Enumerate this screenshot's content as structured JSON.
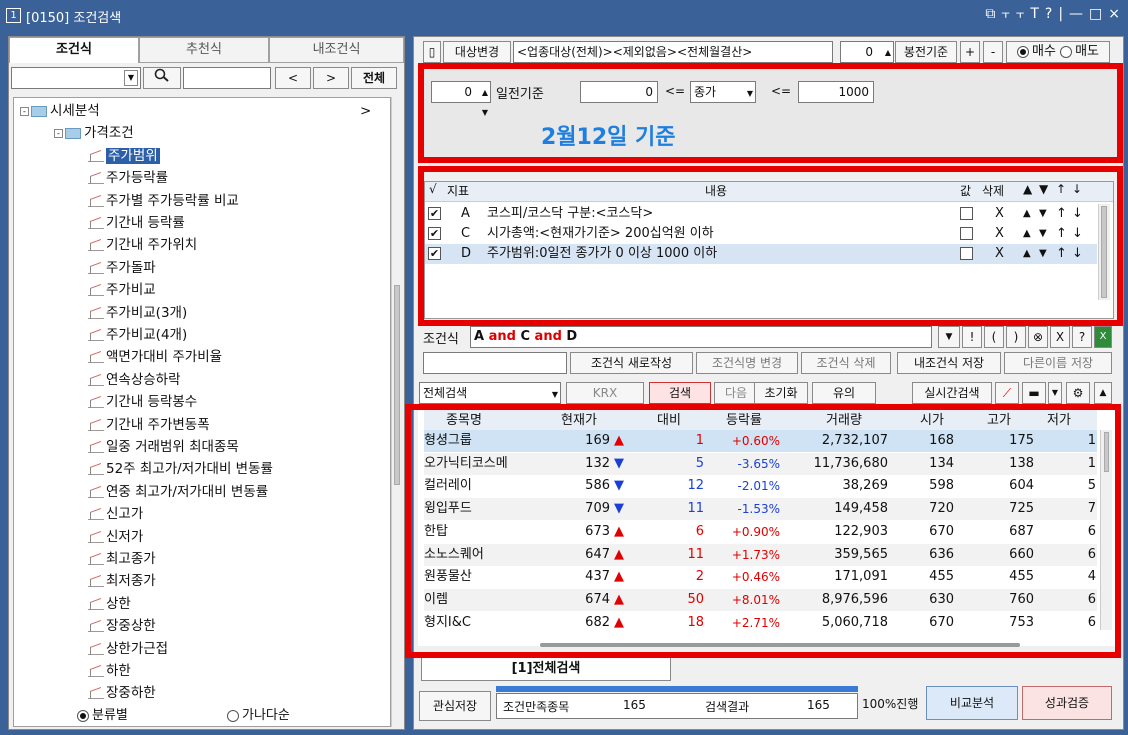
{
  "window": {
    "number": "1",
    "title": "[0150] 조건검색",
    "controls": [
      "⧉",
      "⫟",
      "⫟",
      "T",
      "?",
      "|",
      "—",
      "□",
      "×"
    ]
  },
  "left": {
    "tabs": [
      "조건식",
      "추천식",
      "내조건식"
    ],
    "all_button": "전체",
    "nav_prev": "<",
    "nav_next": ">",
    "tree": [
      {
        "label": "시세분석",
        "level": 0,
        "type": "folder",
        "expand": "-",
        "arrow": ">"
      },
      {
        "label": "가격조건",
        "level": 1,
        "type": "folder",
        "expand": "-"
      },
      {
        "label": "주가범위",
        "level": 2,
        "type": "item",
        "selected": true
      },
      {
        "label": "주가등락률",
        "level": 2,
        "type": "item"
      },
      {
        "label": "주가별 주가등락률 비교",
        "level": 2,
        "type": "item"
      },
      {
        "label": "기간내 등락률",
        "level": 2,
        "type": "item"
      },
      {
        "label": "기간내 주가위치",
        "level": 2,
        "type": "item"
      },
      {
        "label": "주가돌파",
        "level": 2,
        "type": "item"
      },
      {
        "label": "주가비교",
        "level": 2,
        "type": "item"
      },
      {
        "label": "주가비교(3개)",
        "level": 2,
        "type": "item"
      },
      {
        "label": "주가비교(4개)",
        "level": 2,
        "type": "item"
      },
      {
        "label": "액면가대비 주가비율",
        "level": 2,
        "type": "item"
      },
      {
        "label": "연속상승하락",
        "level": 2,
        "type": "item"
      },
      {
        "label": "기간내 등락봉수",
        "level": 2,
        "type": "item"
      },
      {
        "label": "기간내 주가변동폭",
        "level": 2,
        "type": "item"
      },
      {
        "label": "일중 거래범위 최대종목",
        "level": 2,
        "type": "item"
      },
      {
        "label": "52주 최고가/저가대비 변동률",
        "level": 2,
        "type": "item"
      },
      {
        "label": "연중 최고가/저가대비 변동률",
        "level": 2,
        "type": "item"
      },
      {
        "label": "신고가",
        "level": 2,
        "type": "item"
      },
      {
        "label": "신저가",
        "level": 2,
        "type": "item"
      },
      {
        "label": "최고종가",
        "level": 2,
        "type": "item"
      },
      {
        "label": "최저종가",
        "level": 2,
        "type": "item"
      },
      {
        "label": "상한",
        "level": 2,
        "type": "item"
      },
      {
        "label": "장중상한",
        "level": 2,
        "type": "item"
      },
      {
        "label": "상한가근접",
        "level": 2,
        "type": "item"
      },
      {
        "label": "하한",
        "level": 2,
        "type": "item"
      },
      {
        "label": "장중하한",
        "level": 2,
        "type": "item"
      }
    ],
    "sort_options": [
      "분류별",
      "가나다순"
    ],
    "sort_selected": "분류별"
  },
  "right": {
    "target_button": "대상변경",
    "target_text": "<업종대상(전체)><제외없음><전체월결산>",
    "bong_value": "0",
    "bong_label": "봉전기준",
    "plus": "+",
    "minus": "-",
    "trade_options": [
      "매수",
      "매도"
    ],
    "trade_selected": "매수",
    "param": {
      "days": "0",
      "days_label": "일전기준",
      "from": "0",
      "op1": "<=",
      "field": "종가",
      "op2": "<=",
      "to": "1000"
    },
    "annotation": "2월12일 기준",
    "cond_header": {
      "check": "√",
      "idx": "지표",
      "content": "내용",
      "value": "값",
      "delete": "삭제",
      "ord": [
        "▲",
        "▼",
        "↑",
        "↓"
      ]
    },
    "conditions": [
      {
        "checked": "✔",
        "idx": "A",
        "text": "코스피/코스닥 구분:<코스닥>",
        "del": "X"
      },
      {
        "checked": "✔",
        "idx": "C",
        "text": "시가총액:<현재가기준> 200십억원 이하",
        "del": "X"
      },
      {
        "checked": "✔",
        "idx": "D",
        "text": "주가범위:0일전 종가가 0 이상 1000 이하",
        "del": "X"
      }
    ],
    "formula_label": "조건식",
    "formula": [
      "A",
      "and",
      "C",
      "and",
      "D"
    ],
    "formula_tools": [
      "▼",
      "!",
      "(",
      ")",
      "⊗",
      "X",
      "?"
    ],
    "buttons_row1": [
      "조건식 새로작성",
      "조건식명 변경",
      "조건식 삭제",
      "내조건식 저장",
      "다른이름 저장"
    ],
    "search_scope": "전체검색",
    "krx": "KRX",
    "search_btn": "검색",
    "next_btn": "다음",
    "reset_btn": "초기화",
    "note_btn": "유의",
    "realtime_btn": "실시간검색",
    "results_header": [
      "종목명",
      "현재가",
      "대비",
      "등락률",
      "거래량",
      "시가",
      "고가",
      "저가"
    ],
    "results": [
      {
        "name": "형셩그룹",
        "price": "169",
        "dir": "up",
        "diff": "1",
        "rate": "+0.60%",
        "vol": "2,732,107",
        "open": "168",
        "high": "175",
        "low": "1"
      },
      {
        "name": "오가닉티코스메",
        "price": "132",
        "dir": "down",
        "diff": "5",
        "rate": "-3.65%",
        "vol": "11,736,680",
        "open": "134",
        "high": "138",
        "low": "1"
      },
      {
        "name": "컬러레이",
        "price": "586",
        "dir": "down",
        "diff": "12",
        "rate": "-2.01%",
        "vol": "38,269",
        "open": "598",
        "high": "604",
        "low": "5"
      },
      {
        "name": "윙입푸드",
        "price": "709",
        "dir": "down",
        "diff": "11",
        "rate": "-1.53%",
        "vol": "149,458",
        "open": "720",
        "high": "725",
        "low": "7"
      },
      {
        "name": "한탑",
        "price": "673",
        "dir": "up",
        "diff": "6",
        "rate": "+0.90%",
        "vol": "122,903",
        "open": "670",
        "high": "687",
        "low": "6"
      },
      {
        "name": "소노스퀘어",
        "price": "647",
        "dir": "up",
        "diff": "11",
        "rate": "+1.73%",
        "vol": "359,565",
        "open": "636",
        "high": "660",
        "low": "6"
      },
      {
        "name": "원풍물산",
        "price": "437",
        "dir": "up",
        "diff": "2",
        "rate": "+0.46%",
        "vol": "171,091",
        "open": "455",
        "high": "455",
        "low": "4"
      },
      {
        "name": "이렘",
        "price": "674",
        "dir": "up",
        "diff": "50",
        "rate": "+8.01%",
        "vol": "8,976,596",
        "open": "630",
        "high": "760",
        "low": "6"
      },
      {
        "name": "형지I&C",
        "price": "682",
        "dir": "up",
        "diff": "18",
        "rate": "+2.71%",
        "vol": "5,060,718",
        "open": "670",
        "high": "753",
        "low": "6"
      }
    ],
    "result_tab": "[1]전체검색",
    "footer": {
      "save": "관심저장",
      "satisfy_label": "조건만족종목",
      "satisfy": "165",
      "result_label": "검색결과",
      "result": "165",
      "progress": "100%진행",
      "progress_value": 1.0,
      "compare": "비교분석",
      "verify": "성과검증"
    }
  }
}
